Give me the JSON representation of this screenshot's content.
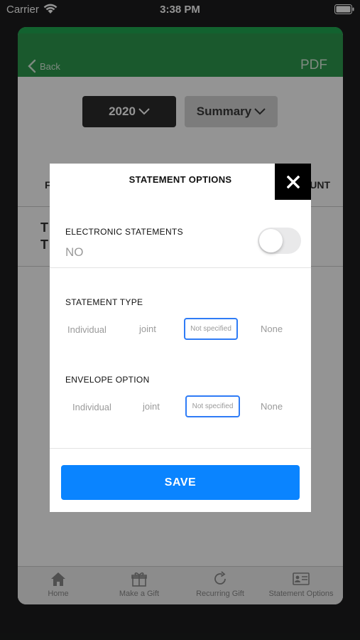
{
  "status_bar": {
    "carrier": "Carrier",
    "time": "3:38 PM"
  },
  "header": {
    "back_label": "Back",
    "pdf_label": "PDF",
    "accent_color": "#1faa52"
  },
  "filters": {
    "year": "2020",
    "view": "Summary"
  },
  "table": {
    "col_left_partial": "F",
    "col_right_partial": "UNT",
    "row_partial_1": "T",
    "row_partial_2": "T"
  },
  "tabbar": {
    "tabs": [
      {
        "label": "Home",
        "icon": "house-icon"
      },
      {
        "label": "Make a Gift",
        "icon": "gift-icon"
      },
      {
        "label": "Recurring Gift",
        "icon": "refresh-icon"
      },
      {
        "label": "Statement Options",
        "icon": "id-card-icon"
      }
    ]
  },
  "modal": {
    "title": "STATEMENT OPTIONS",
    "electronic_label": "ELECTRONIC STATEMENTS",
    "electronic_value": "NO",
    "electronic_enabled": false,
    "statement_type": {
      "label": "STATEMENT TYPE",
      "options": [
        "Individual",
        "joint",
        "Not specified",
        "None"
      ],
      "selected": "Not specified"
    },
    "envelope_option": {
      "label": "ENVELOPE OPTION",
      "options": [
        "Individual",
        "joint",
        "Not specified",
        "None"
      ],
      "selected": "Not specified"
    },
    "save_label": "SAVE",
    "selected_color": "#2f7cf6",
    "save_color": "#0a84ff"
  }
}
